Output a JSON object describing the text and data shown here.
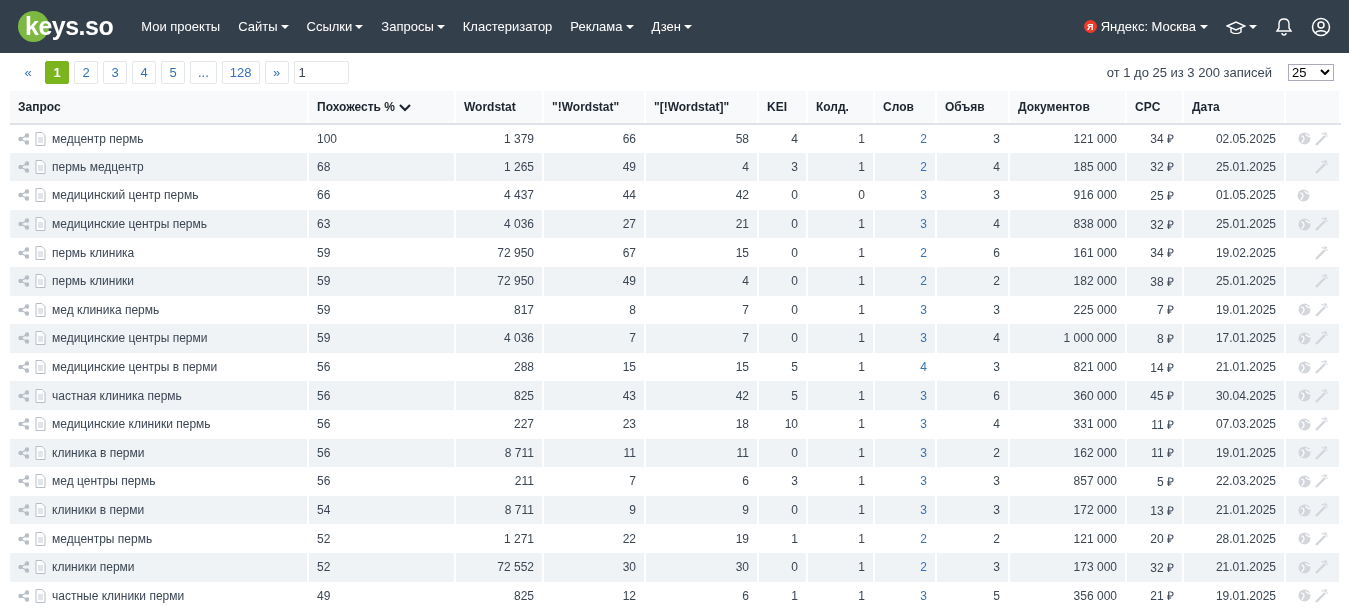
{
  "header": {
    "logo": "keys.so",
    "nav": [
      {
        "label": "Мои проекты",
        "dropdown": false
      },
      {
        "label": "Сайты",
        "dropdown": true
      },
      {
        "label": "Ссылки",
        "dropdown": true
      },
      {
        "label": "Запросы",
        "dropdown": true
      },
      {
        "label": "Кластеризатор",
        "dropdown": false
      },
      {
        "label": "Реклама",
        "dropdown": true
      },
      {
        "label": "Дзен",
        "dropdown": true
      }
    ],
    "region_badge": "Я",
    "region": "Яндекс: Москва"
  },
  "pagination": {
    "prev": "«",
    "pages": [
      {
        "label": "1",
        "selected": true
      },
      {
        "label": "2",
        "selected": false
      },
      {
        "label": "3",
        "selected": false
      },
      {
        "label": "4",
        "selected": false
      },
      {
        "label": "5",
        "selected": false
      },
      {
        "label": "...",
        "selected": false
      },
      {
        "label": "128",
        "selected": false
      }
    ],
    "next": "»",
    "page_input": "1",
    "summary": "от 1 до 25 из 3 200 записей",
    "per_page": "25"
  },
  "table": {
    "columns": [
      {
        "label": "Запрос",
        "sorted": false
      },
      {
        "label": "Похожесть %",
        "sorted": true
      },
      {
        "label": "Wordstat",
        "sorted": false
      },
      {
        "label": "\"!Wordstat\"",
        "sorted": false
      },
      {
        "label": "\"[!Wordstat]\"",
        "sorted": false
      },
      {
        "label": "KEI",
        "sorted": false
      },
      {
        "label": "Колд.",
        "sorted": false
      },
      {
        "label": "Слов",
        "sorted": false
      },
      {
        "label": "Объяв",
        "sorted": false
      },
      {
        "label": "Документов",
        "sorted": false
      },
      {
        "label": "CPC",
        "sorted": false
      },
      {
        "label": "Дата",
        "sorted": false
      }
    ],
    "rows": [
      {
        "cells": [
          "медцентр пермь",
          "100",
          "1 379",
          "66",
          "58",
          "4",
          "1",
          "2",
          "3",
          "121 000",
          "34 ₽",
          "02.05.2025"
        ],
        "globe": true,
        "wand": true
      },
      {
        "cells": [
          "пермь медцентр",
          "68",
          "1 265",
          "49",
          "4",
          "3",
          "1",
          "2",
          "4",
          "185 000",
          "32 ₽",
          "25.01.2025"
        ],
        "globe": false,
        "wand": true
      },
      {
        "cells": [
          "медицинский центр пермь",
          "66",
          "4 437",
          "44",
          "42",
          "0",
          "0",
          "3",
          "3",
          "916 000",
          "25 ₽",
          "01.05.2025"
        ],
        "globe": true,
        "wand": false
      },
      {
        "cells": [
          "медицинские центры пермь",
          "63",
          "4 036",
          "27",
          "21",
          "0",
          "1",
          "3",
          "4",
          "838 000",
          "32 ₽",
          "25.01.2025"
        ],
        "globe": true,
        "wand": true
      },
      {
        "cells": [
          "пермь клиника",
          "59",
          "72 950",
          "67",
          "15",
          "0",
          "1",
          "2",
          "6",
          "161 000",
          "34 ₽",
          "19.02.2025"
        ],
        "globe": false,
        "wand": true
      },
      {
        "cells": [
          "пермь клиники",
          "59",
          "72 950",
          "49",
          "4",
          "0",
          "1",
          "2",
          "2",
          "182 000",
          "38 ₽",
          "25.01.2025"
        ],
        "globe": false,
        "wand": true
      },
      {
        "cells": [
          "мед клиника пермь",
          "59",
          "817",
          "8",
          "7",
          "0",
          "1",
          "3",
          "3",
          "225 000",
          "7 ₽",
          "19.01.2025"
        ],
        "globe": true,
        "wand": true
      },
      {
        "cells": [
          "медицинские центры перми",
          "59",
          "4 036",
          "7",
          "7",
          "0",
          "1",
          "3",
          "4",
          "1 000 000",
          "8 ₽",
          "17.01.2025"
        ],
        "globe": true,
        "wand": true
      },
      {
        "cells": [
          "медицинские центры в перми",
          "56",
          "288",
          "15",
          "15",
          "5",
          "1",
          "4",
          "3",
          "821 000",
          "14 ₽",
          "21.01.2025"
        ],
        "globe": true,
        "wand": true
      },
      {
        "cells": [
          "частная клиника пермь",
          "56",
          "825",
          "43",
          "42",
          "5",
          "1",
          "3",
          "6",
          "360 000",
          "45 ₽",
          "30.04.2025"
        ],
        "globe": true,
        "wand": true
      },
      {
        "cells": [
          "медицинские клиники пермь",
          "56",
          "227",
          "23",
          "18",
          "10",
          "1",
          "3",
          "4",
          "331 000",
          "11 ₽",
          "07.03.2025"
        ],
        "globe": true,
        "wand": true
      },
      {
        "cells": [
          "клиника в перми",
          "56",
          "8 711",
          "11",
          "11",
          "0",
          "1",
          "3",
          "2",
          "162 000",
          "11 ₽",
          "19.01.2025"
        ],
        "globe": true,
        "wand": true
      },
      {
        "cells": [
          "мед центры пермь",
          "56",
          "211",
          "7",
          "6",
          "3",
          "1",
          "3",
          "3",
          "857 000",
          "5 ₽",
          "22.03.2025"
        ],
        "globe": true,
        "wand": true
      },
      {
        "cells": [
          "клиники в перми",
          "54",
          "8 711",
          "9",
          "9",
          "0",
          "1",
          "3",
          "3",
          "172 000",
          "13 ₽",
          "21.01.2025"
        ],
        "globe": true,
        "wand": true
      },
      {
        "cells": [
          "медцентры пермь",
          "52",
          "1 271",
          "22",
          "19",
          "1",
          "1",
          "2",
          "2",
          "121 000",
          "20 ₽",
          "28.01.2025"
        ],
        "globe": true,
        "wand": true
      },
      {
        "cells": [
          "клиники перми",
          "52",
          "72 552",
          "30",
          "30",
          "0",
          "1",
          "2",
          "3",
          "173 000",
          "32 ₽",
          "21.01.2025"
        ],
        "globe": true,
        "wand": true
      },
      {
        "cells": [
          "частные клиники перми",
          "49",
          "825",
          "12",
          "6",
          "1",
          "1",
          "3",
          "5",
          "356 000",
          "21 ₽",
          "19.01.2025"
        ],
        "globe": true,
        "wand": true
      }
    ]
  }
}
